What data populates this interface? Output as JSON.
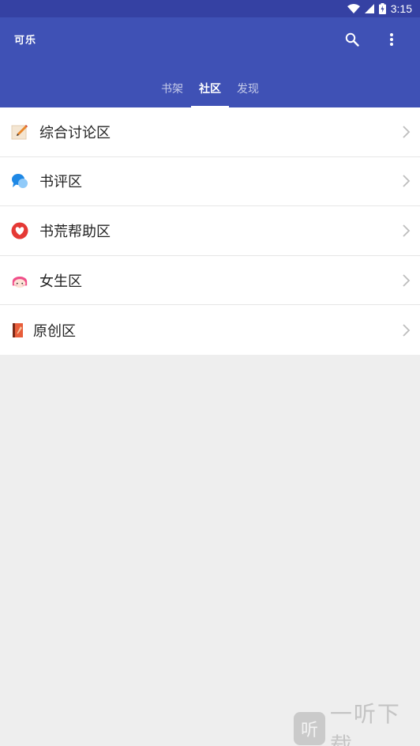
{
  "status_bar": {
    "time": "3:15"
  },
  "app_bar": {
    "title": "可乐",
    "tabs": [
      {
        "label": "书架",
        "active": false
      },
      {
        "label": "社区",
        "active": true
      },
      {
        "label": "发现",
        "active": false
      }
    ]
  },
  "community": {
    "items": [
      {
        "label": "综合讨论区",
        "icon": "memo-pencil-icon"
      },
      {
        "label": "书评区",
        "icon": "chat-bubbles-icon"
      },
      {
        "label": "书荒帮助区",
        "icon": "heart-icon"
      },
      {
        "label": "女生区",
        "icon": "girl-face-icon"
      },
      {
        "label": "原创区",
        "icon": "book-pen-icon"
      }
    ]
  },
  "watermark": {
    "badge": "听",
    "text": "一听下载"
  },
  "colors": {
    "status_bar": "#3541a3",
    "app_bar": "#3f51b5",
    "background": "#eeeeee",
    "heart": "#e53935",
    "bubbles": "#1e88e5",
    "girl": "#f0508a"
  }
}
